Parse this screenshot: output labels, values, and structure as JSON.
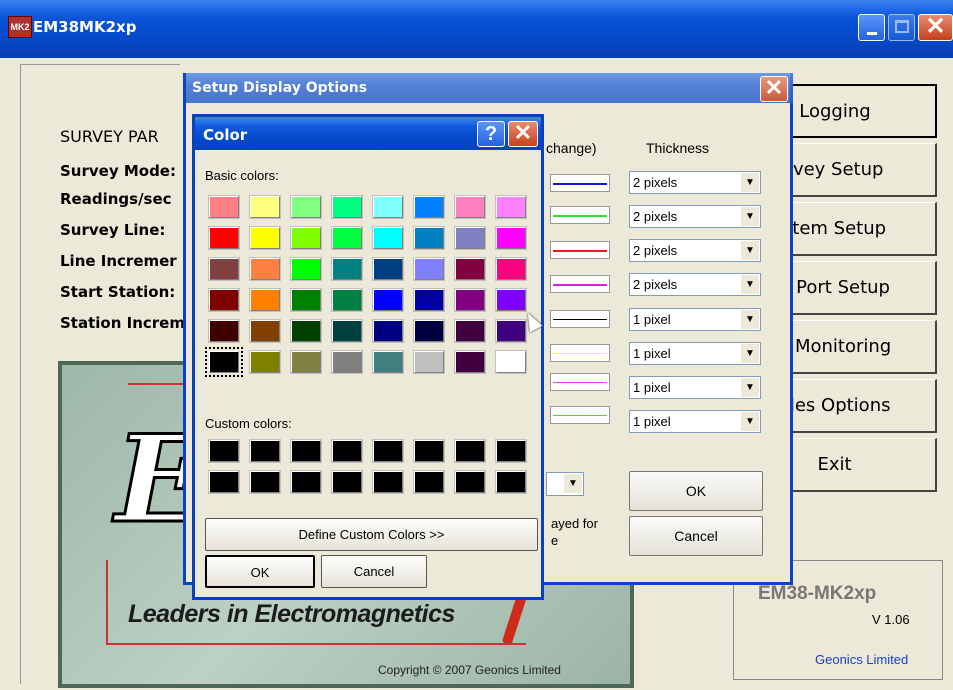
{
  "window": {
    "title": "EM38MK2xp",
    "icon_text": "MK2"
  },
  "survey": {
    "heading": "SURVEY PAR",
    "labels": [
      "Survey Mode:",
      "Readings/sec",
      "Survey Line:",
      "Line Incremer",
      "Start Station:",
      "Station Increm"
    ]
  },
  "right_buttons": [
    "Logging",
    "rvey Setup",
    "stem Setup",
    "S Port Setup",
    "S Monitoring",
    "files Options",
    "Exit"
  ],
  "info": {
    "name": "EM38-MK2xp",
    "version": "V 1.06",
    "company": "Geonics Limited"
  },
  "logo": {
    "letter": "E",
    "tagline": "Leaders in Electromagnetics",
    "copyright": "Copyright © 2007 Geonics Limited"
  },
  "setup_dialog": {
    "title": "Setup Display Options",
    "col_header_change": "change)",
    "col_header_thickness": "Thickness",
    "rows": [
      {
        "thickness": "2 pixels",
        "color": "#1a1ad0"
      },
      {
        "thickness": "2 pixels",
        "color": "#30e030"
      },
      {
        "thickness": "2 pixels",
        "color": "#e02020"
      },
      {
        "thickness": "2 pixels",
        "color": "#e020e0"
      },
      {
        "thickness": "1 pixel",
        "color": "#000000"
      },
      {
        "thickness": "1 pixel",
        "color": "#f0f060"
      },
      {
        "thickness": "1 pixel",
        "color": "#e040e0"
      },
      {
        "thickness": "1 pixel",
        "color": "#40e040"
      }
    ],
    "displayed_text_1": "ayed for",
    "displayed_text_2": "e",
    "ok_label": "OK",
    "cancel_label": "Cancel"
  },
  "color_dialog": {
    "title": "Color",
    "help": "?",
    "basic_colors_label": "Basic colors:",
    "basic_colors": [
      [
        "#ff8080",
        "#ffff80",
        "#80ff80",
        "#00ff80",
        "#80ffff",
        "#0080ff",
        "#ff80c0",
        "#ff80ff"
      ],
      [
        "#ff0000",
        "#ffff00",
        "#80ff00",
        "#00ff40",
        "#00ffff",
        "#0080c0",
        "#8080c0",
        "#ff00ff"
      ],
      [
        "#804040",
        "#ff8040",
        "#00ff00",
        "#008080",
        "#004080",
        "#8080ff",
        "#800040",
        "#ff0080"
      ],
      [
        "#800000",
        "#ff8000",
        "#008000",
        "#008040",
        "#0000ff",
        "#0000a0",
        "#800080",
        "#8000ff"
      ],
      [
        "#400000",
        "#804000",
        "#004000",
        "#004040",
        "#000080",
        "#000040",
        "#400040",
        "#400080"
      ],
      [
        "#000000",
        "#808000",
        "#808040",
        "#808080",
        "#408080",
        "#c0c0c0",
        "#400040",
        "#ffffff"
      ]
    ],
    "custom_colors_label": "Custom colors:",
    "custom_colors": [
      [
        "#000000",
        "#000000",
        "#000000",
        "#000000",
        "#000000",
        "#000000",
        "#000000",
        "#000000"
      ],
      [
        "#000000",
        "#000000",
        "#000000",
        "#000000",
        "#000000",
        "#000000",
        "#000000",
        "#000000"
      ]
    ],
    "define_label": "Define Custom Colors >>",
    "ok_label": "OK",
    "cancel_label": "Cancel"
  }
}
